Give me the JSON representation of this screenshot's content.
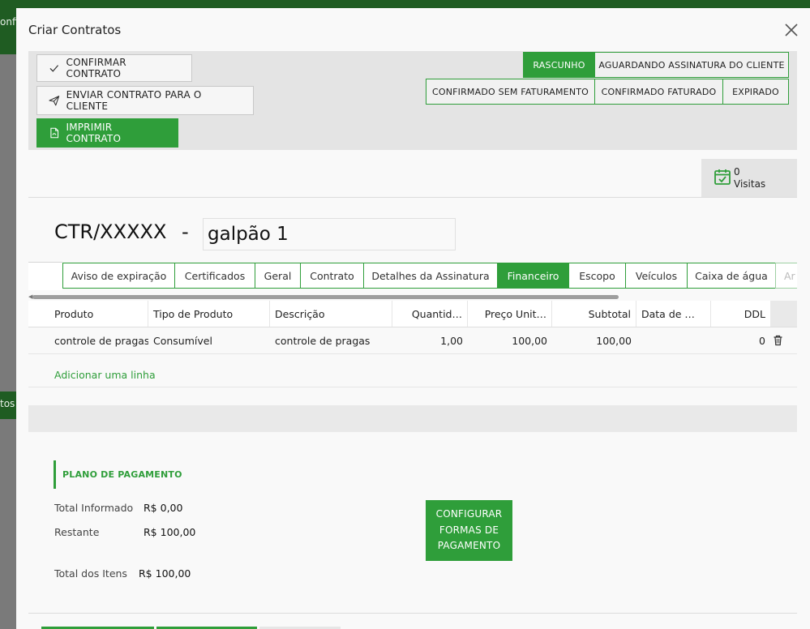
{
  "background": {
    "topbar_fragment": "onfi",
    "side_fragment": "tos"
  },
  "modal": {
    "title": "Criar Contratos"
  },
  "actions": {
    "confirm": "CONFIRMAR CONTRATO",
    "send": "ENVIAR CONTRATO PARA O CLIENTE",
    "print": "IMPRIMIR CONTRATO"
  },
  "stages": [
    {
      "label": "RASCUNHO",
      "active": true
    },
    {
      "label": "AGUARDANDO ASSINATURA DO CLIENTE",
      "active": false
    },
    {
      "label": "CONFIRMADO SEM FATURAMENTO",
      "active": false
    },
    {
      "label": "CONFIRMADO FATURADO",
      "active": false
    },
    {
      "label": "EXPIRADO",
      "active": false
    }
  ],
  "visits": {
    "count": "0",
    "label": "Visitas"
  },
  "contract": {
    "reference": "CTR/XXXXX",
    "separator": "-",
    "name": "galpão 1"
  },
  "tabs": [
    {
      "label": "Aviso de expiração",
      "active": false
    },
    {
      "label": "Certificados",
      "active": false
    },
    {
      "label": "Geral",
      "active": false
    },
    {
      "label": "Contrato",
      "active": false
    },
    {
      "label": "Detalhes da Assinatura",
      "active": false
    },
    {
      "label": "Financeiro",
      "active": true
    },
    {
      "label": "Escopo",
      "active": false
    },
    {
      "label": "Veículos",
      "active": false
    },
    {
      "label": "Caixa de água",
      "active": false
    },
    {
      "label": "Ar",
      "active": false
    }
  ],
  "table": {
    "columns": [
      "Produto",
      "Tipo de Produto",
      "Descrição",
      "Quantid…",
      "Preço Unit…",
      "Subtotal",
      "Data de …",
      "DDL"
    ],
    "rows": [
      [
        "controle de pragas",
        "Consumível",
        "controle de pragas",
        "1,00",
        "100,00",
        "100,00",
        "",
        "0"
      ]
    ],
    "add_line": "Adicionar uma linha"
  },
  "payment_plan": {
    "header": "PLANO DE PAGAMENTO",
    "total_informed_label": "Total Informado",
    "total_informed_value": "R$ 0,00",
    "remaining_label": "Restante",
    "remaining_value": "R$ 100,00",
    "total_items_label": "Total dos Itens",
    "total_items_value": "R$ 100,00",
    "configure_button": "CONFIGURAR FORMAS DE PAGAMENTO"
  },
  "colors": {
    "brand_green": "#2f9e3a",
    "dark_green": "#1f5c22"
  }
}
